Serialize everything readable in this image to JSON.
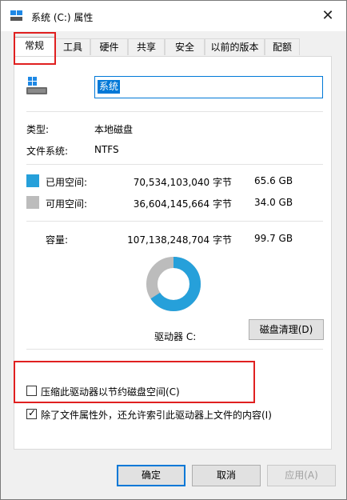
{
  "window": {
    "title": "系统 (C:) 属性",
    "close_glyph": "✕"
  },
  "tabs": [
    "常规",
    "工具",
    "硬件",
    "共享",
    "安全",
    "以前的版本",
    "配额"
  ],
  "drive": {
    "name": "系统"
  },
  "info": {
    "type_label": "类型:",
    "type_value": "本地磁盘",
    "fs_label": "文件系统:",
    "fs_value": "NTFS"
  },
  "space": {
    "used_label": "已用空间:",
    "used_bytes": "70,534,103,040 字节",
    "used_gb": "65.6 GB",
    "used_color": "#26a0da",
    "free_label": "可用空间:",
    "free_bytes": "36,604,145,664 字节",
    "free_gb": "34.0 GB",
    "free_color": "#bcbcbc",
    "capacity_label": "容量:",
    "capacity_bytes": "107,138,248,704 字节",
    "capacity_gb": "99.7 GB",
    "used_fraction": 0.658
  },
  "drive_label": "驱动器 C:",
  "cleanup_button": "磁盘清理(D)",
  "compress_checkbox": {
    "label": "压缩此驱动器以节约磁盘空间(C)",
    "checked": false
  },
  "index_checkbox": {
    "label": "除了文件属性外，还允许索引此驱动器上文件的内容(I)",
    "checked": true,
    "check_glyph": "✓"
  },
  "buttons": {
    "ok": "确定",
    "cancel": "取消",
    "apply": "应用(A)"
  }
}
